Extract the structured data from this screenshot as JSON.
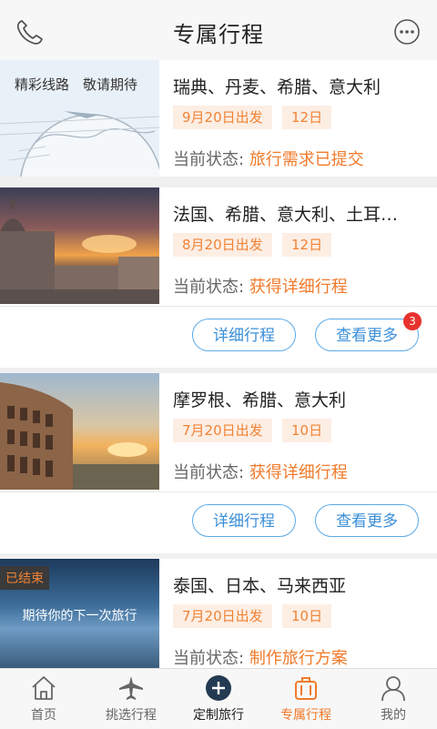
{
  "header": {
    "title": "专属行程",
    "left_icon": "phone-icon",
    "right_icon": "chat-icon"
  },
  "trips": [
    {
      "image": "world-map",
      "image_text": "精彩线路　敬请期待",
      "destinations": "瑞典、丹麦、希腊、意大利",
      "date": "9月20日出发",
      "days": "12日",
      "status_label": "当前状态:",
      "status": "旅行需求已提交"
    },
    {
      "image": "vatican-sunset",
      "destinations": "法国、希腊、意大利、土耳…",
      "date": "8月20日出发",
      "days": "12日",
      "status_label": "当前状态:",
      "status": "获得详细行程",
      "detail_button": "详细行程",
      "more_button": "查看更多",
      "more_badge": "3"
    },
    {
      "image": "colosseum",
      "destinations": "摩罗根、希腊、意大利",
      "date": "7月20日出发",
      "days": "10日",
      "status_label": "当前状态:",
      "status": "获得详细行程",
      "detail_button": "详细行程",
      "more_button": "查看更多"
    },
    {
      "image": "blurred-beach",
      "ended_tag": "已结束",
      "image_text": "期待你的下一次旅行",
      "destinations": "泰国、日本、马来西亚",
      "date": "7月20日出发",
      "days": "10日",
      "status_label": "当前状态:",
      "status": "制作旅行方案"
    }
  ],
  "tabbar": [
    {
      "label": "首页",
      "icon": "home-icon"
    },
    {
      "label": "挑选行程",
      "icon": "plane-icon"
    },
    {
      "label": "定制旅行",
      "icon": "plus-circle-icon"
    },
    {
      "label": "专属行程",
      "icon": "suitcase-icon",
      "active": true
    },
    {
      "label": "我的",
      "icon": "user-icon"
    }
  ],
  "colors": {
    "accent_orange": "#f07a2a",
    "accent_blue": "#3b8fd9",
    "badge_red": "#e8322d"
  }
}
